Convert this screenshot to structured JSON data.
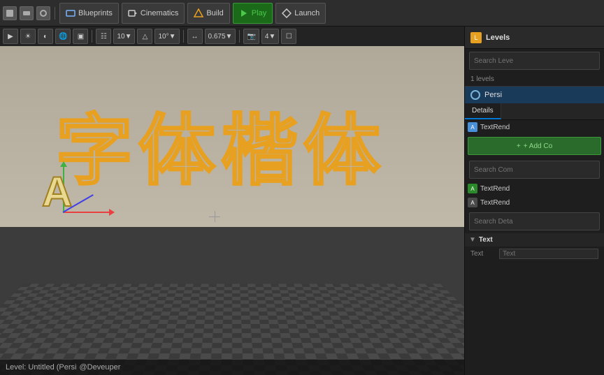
{
  "toolbar": {
    "blueprints_label": "Blueprints",
    "cinematics_label": "Cinematics",
    "build_label": "Build",
    "play_label": "Play",
    "launch_label": "Launch"
  },
  "viewport": {
    "grid_size": "10",
    "rotation_snap": "10°",
    "scale": "0.675",
    "camera_speed": "4",
    "chinese_text": "字体楷体",
    "actor_letter": "A",
    "crosshair": "+"
  },
  "status_bar": {
    "text": "Level:  Untitled (Persi",
    "user": "@Deveuper"
  },
  "right_panel": {
    "levels_title": "Levels",
    "search_levels_placeholder": "Search Leve",
    "levels_count": "1 levels",
    "persistent_level": "Persi",
    "details_tab": "Details",
    "component_search_placeholder": "Search Com",
    "add_component_label": "+ Add Co",
    "components": [
      {
        "name": "TextRend",
        "type": "text"
      },
      {
        "name": "TextRend",
        "type": "text"
      }
    ],
    "text_section_title": "Text",
    "text_property_label": "Text",
    "text_property_placeholder": "Text",
    "search_details_placeholder": "Search Deta"
  }
}
